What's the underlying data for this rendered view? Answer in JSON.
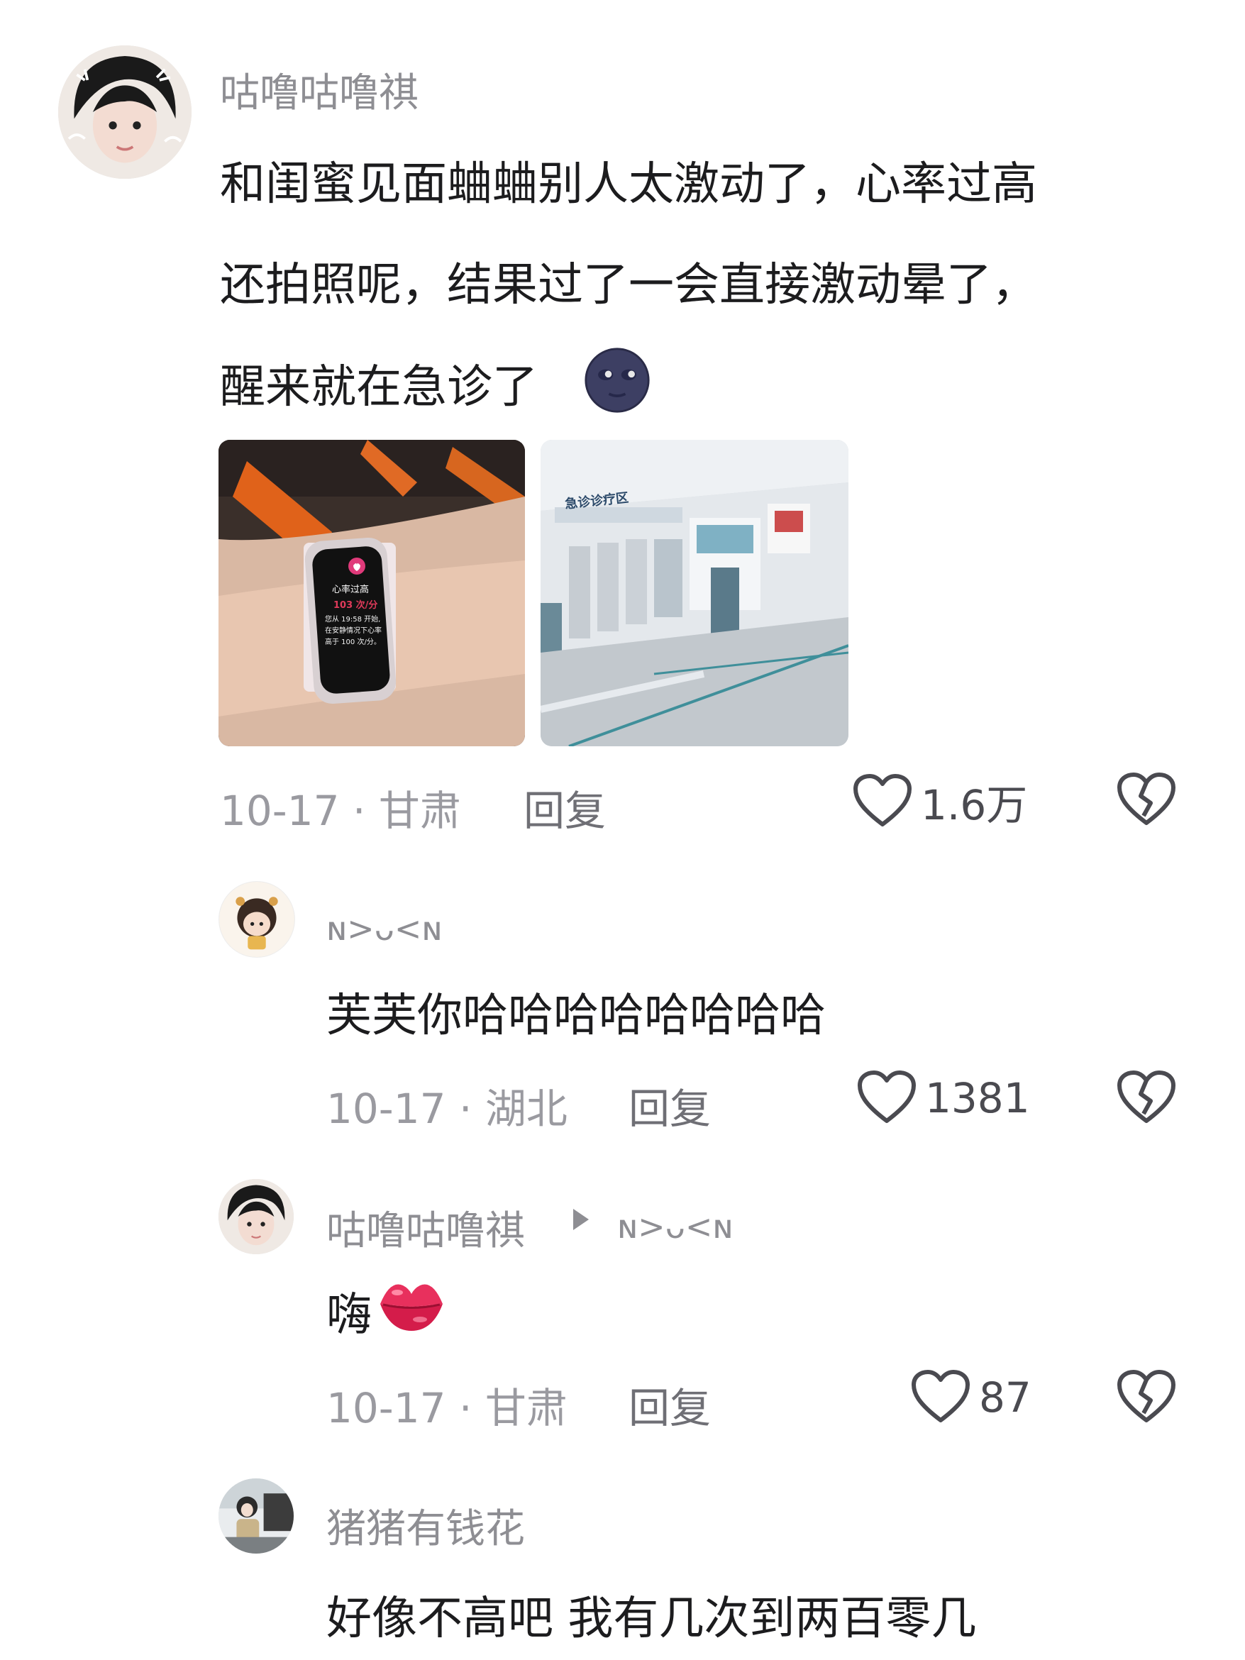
{
  "comments": [
    {
      "username": "咕噜咕噜祺",
      "lines": [
        "和闺蜜见面蛐蛐别人太激动了，心率过高",
        "还拍照呢，结果过了一会直接激动晕了，",
        "醒来就在急诊了"
      ],
      "emoji": "new-moon-face-icon",
      "images": [
        {
          "name": "watch-photo",
          "watch_texts": [
            "心率过高",
            "103 次/分",
            "您从 19:58 开始,",
            "在安静情况下心率",
            "高于 100 次/分。"
          ]
        },
        {
          "name": "hospital-photo",
          "sign_text": "急诊诊疗区"
        }
      ],
      "meta": "10-17 · 甘肃",
      "reply_label": "回复",
      "likes": "1.6万"
    },
    {
      "username": "ɴ>ᴗ<ɴ",
      "text": "芙芙你哈哈哈哈哈哈哈哈",
      "meta": "10-17 · 湖北",
      "reply_label": "回复",
      "likes": "1381"
    },
    {
      "username": "咕噜咕噜祺",
      "reply_to": "ɴ>ᴗ<ɴ",
      "text": "嗨",
      "emoji": "kiss-mark-icon",
      "meta": "10-17 · 甘肃",
      "reply_label": "回复",
      "likes": "87"
    },
    {
      "username": "猪猪有钱花",
      "text": "好像不高吧 我有几次到两百零几"
    }
  ],
  "colors": {
    "username": "#8e8e93",
    "text": "#1c1c1e",
    "meta": "#9a9aa0",
    "icon": "#4a4a50"
  }
}
